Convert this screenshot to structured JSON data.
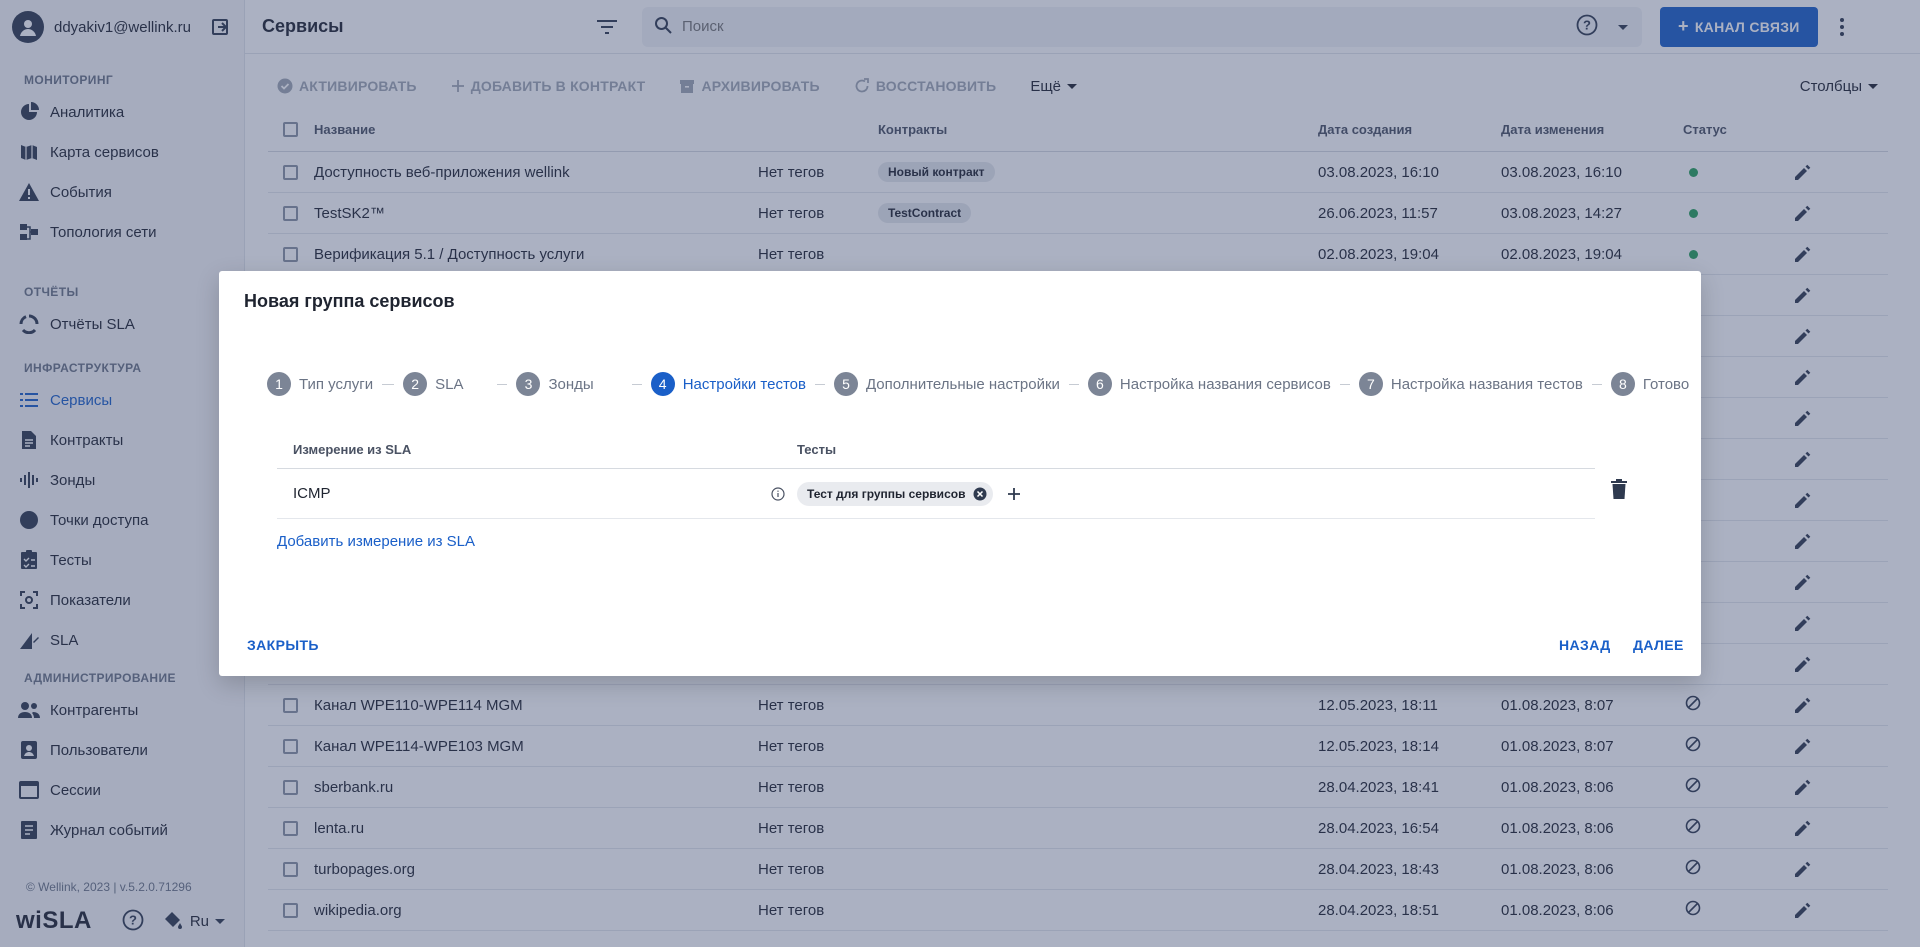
{
  "user": {
    "email": "ddyakiv1@wellink.ru"
  },
  "sidebar": {
    "sections": [
      {
        "title": "МОНИТОРИНГ",
        "items": [
          {
            "label": "Аналитика",
            "icon": "pie-chart-icon"
          },
          {
            "label": "Карта сервисов",
            "icon": "map-icon"
          },
          {
            "label": "События",
            "icon": "warning-icon"
          },
          {
            "label": "Топология сети",
            "icon": "topology-icon"
          }
        ]
      },
      {
        "title": "ОТЧЁТЫ",
        "items": [
          {
            "label": "Отчёты SLA",
            "icon": "circle-report-icon"
          }
        ]
      },
      {
        "title": "ИНФРАСТРУКТУРА",
        "items": [
          {
            "label": "Сервисы",
            "icon": "list-icon",
            "active": true
          },
          {
            "label": "Контракты",
            "icon": "document-icon"
          },
          {
            "label": "Зонды",
            "icon": "probe-icon"
          },
          {
            "label": "Точки доступа",
            "icon": "circle-icon"
          },
          {
            "label": "Тесты",
            "icon": "checklist-icon"
          },
          {
            "label": "Показатели",
            "icon": "gauge-icon"
          },
          {
            "label": "SLA",
            "icon": "sla-icon"
          }
        ]
      },
      {
        "title": "АДМИНИСТРИРОВАНИЕ",
        "items": [
          {
            "label": "Контрагенты",
            "icon": "people-icon"
          },
          {
            "label": "Пользователи",
            "icon": "user-badge-icon"
          },
          {
            "label": "Сессии",
            "icon": "window-icon"
          },
          {
            "label": "Журнал событий",
            "icon": "journal-icon"
          }
        ]
      }
    ],
    "copyright": "© Wellink, 2023 | v.5.2.0.71296",
    "logo": "wiSLA",
    "language": "Ru"
  },
  "topbar": {
    "title": "Сервисы",
    "search_placeholder": "Поиск",
    "primary_button": "КАНАЛ СВЯЗИ"
  },
  "toolbar": {
    "activate": "АКТИВИРОВАТЬ",
    "add_to_contract": "ДОБАВИТЬ В КОНТРАКТ",
    "archive": "АРХИВИРОВАТЬ",
    "restore": "ВОССТАНОВИТЬ",
    "more": "Ещё",
    "columns": "Столбцы"
  },
  "table": {
    "headers": {
      "name": "Название",
      "contracts": "Контракты",
      "created": "Дата создания",
      "changed": "Дата изменения",
      "status": "Статус"
    },
    "rows_top": [
      {
        "name": "Доступность веб-приложения wellink",
        "tags": "Нет тегов",
        "contract": "Новый контракт",
        "created": "03.08.2023, 16:10",
        "changed": "03.08.2023, 16:10",
        "status": "active"
      },
      {
        "name": "TestSK2™",
        "tags": "Нет тегов",
        "contract": "TestContract",
        "created": "26.06.2023, 11:57",
        "changed": "03.08.2023, 14:27",
        "status": "active"
      },
      {
        "name": "Верификация 5.1 / Доступность услуги",
        "tags": "Нет тегов",
        "contract": "",
        "created": "02.08.2023, 19:04",
        "changed": "02.08.2023, 19:04",
        "status": "active"
      }
    ],
    "rows_bottom": [
      {
        "name": "Канал WPE110-WPE114 MGM",
        "tags": "Нет тегов",
        "created": "12.05.2023, 18:11",
        "changed": "01.08.2023, 8:07",
        "status": "disabled"
      },
      {
        "name": "Канал WPE114-WPE103 MGM",
        "tags": "Нет тегов",
        "created": "12.05.2023, 18:14",
        "changed": "01.08.2023, 8:07",
        "status": "disabled"
      },
      {
        "name": "sberbank.ru",
        "tags": "Нет тегов",
        "created": "28.04.2023, 18:41",
        "changed": "01.08.2023, 8:06",
        "status": "disabled"
      },
      {
        "name": "lenta.ru",
        "tags": "Нет тегов",
        "created": "28.04.2023, 16:54",
        "changed": "01.08.2023, 8:06",
        "status": "disabled"
      },
      {
        "name": "turbopages.org",
        "tags": "Нет тегов",
        "created": "28.04.2023, 18:43",
        "changed": "01.08.2023, 8:06",
        "status": "disabled"
      },
      {
        "name": "wikipedia.org",
        "tags": "Нет тегов",
        "created": "28.04.2023, 18:51",
        "changed": "01.08.2023, 8:06",
        "status": "disabled"
      }
    ]
  },
  "modal": {
    "title": "Новая группа сервисов",
    "steps": [
      {
        "num": "1",
        "label": "Тип услуги"
      },
      {
        "num": "2",
        "label": "SLA"
      },
      {
        "num": "3",
        "label": "Зонды"
      },
      {
        "num": "4",
        "label": "Настройки тестов",
        "active": true
      },
      {
        "num": "5",
        "label": "Дополнительные настройки"
      },
      {
        "num": "6",
        "label": "Настройка названия сервисов"
      },
      {
        "num": "7",
        "label": "Настройка названия тестов"
      },
      {
        "num": "8",
        "label": "Готово"
      }
    ],
    "table": {
      "col_measure": "Измерение из SLA",
      "col_tests": "Тесты",
      "row": {
        "measure": "ICMP",
        "test_chip": "Тест для группы сервисов"
      }
    },
    "add_link": "Добавить измерение из SLA",
    "close": "ЗАКРЫТЬ",
    "back": "НАЗАД",
    "next": "ДАЛЕЕ"
  },
  "colors": {
    "accent": "#1a5fc8",
    "status_green": "#27a05a",
    "overlay": "#37466e"
  }
}
